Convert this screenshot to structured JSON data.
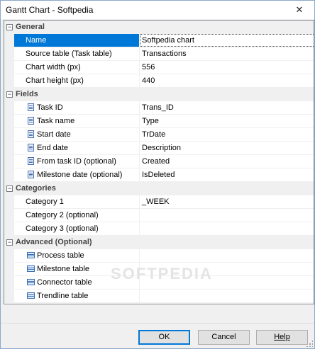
{
  "window": {
    "title": "Gantt Chart - Softpedia",
    "close_glyph": "✕"
  },
  "grid": {
    "categories": {
      "general": {
        "toggle": "−",
        "label": "General"
      },
      "fields": {
        "toggle": "−",
        "label": "Fields"
      },
      "categories": {
        "toggle": "−",
        "label": "Categories"
      },
      "advanced": {
        "toggle": "−",
        "label": "Advanced (Optional)"
      }
    },
    "general": {
      "name": {
        "label": "Name",
        "value": "Softpedia chart"
      },
      "source_table": {
        "label": "Source table (Task table)",
        "value": "Transactions"
      },
      "chart_width": {
        "label": "Chart width (px)",
        "value": "556"
      },
      "chart_height": {
        "label": "Chart height (px)",
        "value": "440"
      }
    },
    "fields": {
      "task_id": {
        "label": "Task ID",
        "value": "Trans_ID",
        "icon": "field-icon"
      },
      "task_name": {
        "label": "Task name",
        "value": "Type",
        "icon": "field-icon"
      },
      "start_date": {
        "label": "Start date",
        "value": "TrDate",
        "icon": "field-icon"
      },
      "end_date": {
        "label": "End date",
        "value": "Description",
        "icon": "field-icon"
      },
      "from_task_id": {
        "label": "From task ID (optional)",
        "value": "Created",
        "icon": "field-icon"
      },
      "milestone_date": {
        "label": "Milestone date (optional)",
        "value": "IsDeleted",
        "icon": "field-icon"
      }
    },
    "cats": {
      "category1": {
        "label": "Category 1",
        "value": "_WEEK"
      },
      "category2": {
        "label": "Category 2 (optional)",
        "value": ""
      },
      "category3": {
        "label": "Category 3 (optional)",
        "value": ""
      }
    },
    "advanced": {
      "process_table": {
        "label": "Process table",
        "value": "",
        "icon": "table-icon"
      },
      "milestone_table": {
        "label": "Milestone table",
        "value": "",
        "icon": "table-icon"
      },
      "connector_table": {
        "label": "Connector table",
        "value": "",
        "icon": "table-icon"
      },
      "trendline_table": {
        "label": "Trendline table",
        "value": "",
        "icon": "table-icon"
      }
    },
    "watermark": "SOFTPEDIA"
  },
  "buttons": {
    "ok": "OK",
    "cancel": "Cancel",
    "help": "Help"
  },
  "colors": {
    "selection": "#0078d7",
    "category_bg": "#f0f0f0",
    "grid_bg": "#ffffff"
  }
}
